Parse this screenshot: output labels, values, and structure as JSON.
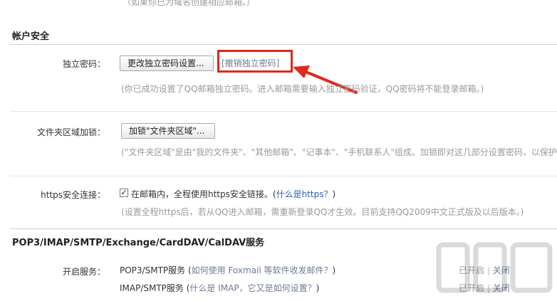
{
  "top_note": "（如果你已为域名创建相应邮箱。）",
  "account_security": {
    "title": "帐户安全",
    "password": {
      "label": "独立密码：",
      "change_button": "更改独立密码设置...",
      "revoke_link": "[撤销独立密码]",
      "note": "(你已成功设置了QQ邮箱独立密码。进入邮箱需要输入独立密码验证，QQ密码将不能登录邮箱。)"
    },
    "folder_lock": {
      "label": "文件夹区域加锁：",
      "button": "加锁\"文件夹区域\"...",
      "note": "(\"文件夹区域\"是由\"我的文件夹\"、\"其他邮箱\"、\"记事本\"、\"手机联系人\"组成。加锁即对这几部分设置密码，以保护"
    },
    "https": {
      "label": "https安全连接：",
      "checkbox_text": "在邮箱内，全程使用https安全链接。(",
      "help_link": "什么是https？",
      "close_paren": ")",
      "checked": true,
      "note": "(设置全程https后，若从QQ进入邮箱，需重新登录QQ才生效。目前支持QQ2009中文正式版及以后版本。)"
    }
  },
  "protocols": {
    "title": "POP3/IMAP/SMTP/Exchange/CardDAV/CalDAV服务",
    "label": "开启服务：",
    "services": [
      {
        "name": "POP3/SMTP服务",
        "help_open": " (",
        "help_link": "如何使用 Foxmail 等软件收发邮件？",
        "help_close": ")",
        "status": "已开启",
        "sep": "|",
        "action": "关闭"
      },
      {
        "name": "IMAP/SMTP服务",
        "help_open": " (",
        "help_link": "什么是 IMAP，它又是如何设置？",
        "help_close": ")",
        "status": "已开启",
        "sep": "|",
        "action": "关闭"
      }
    ]
  },
  "colors": {
    "annotation_red": "#e0281b",
    "link_blue": "#2a5db0"
  }
}
